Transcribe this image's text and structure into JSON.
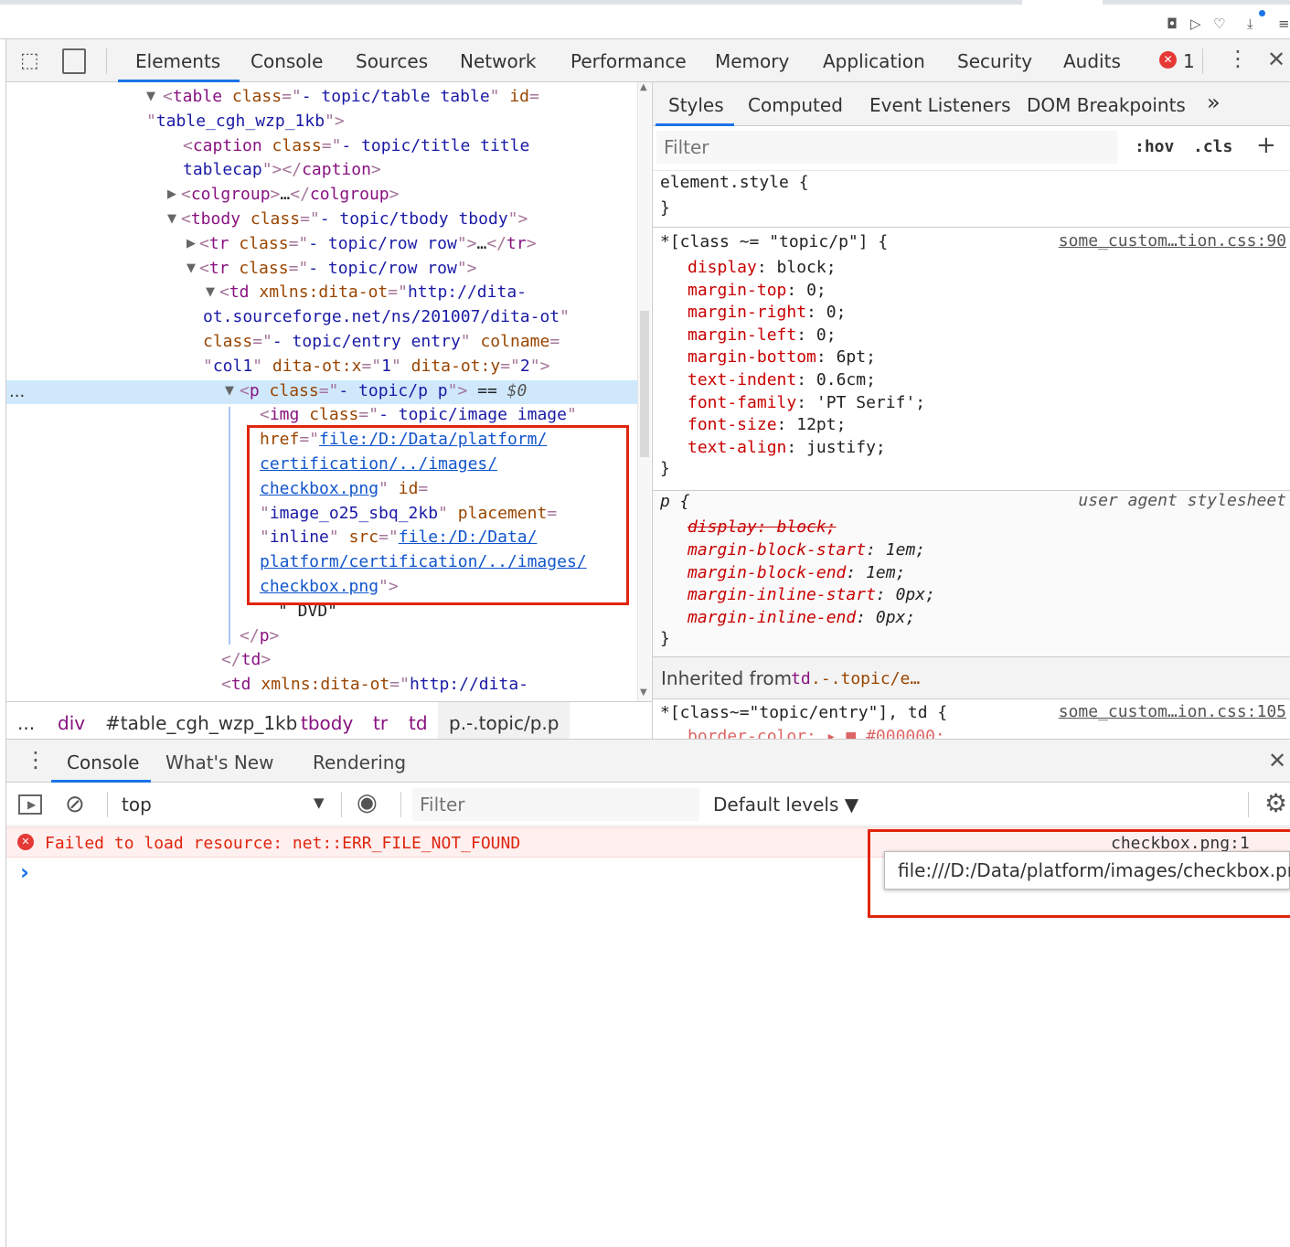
{
  "browser": {
    "icons": [
      "camera-icon",
      "send-icon",
      "heart-icon",
      "download-icon",
      "menu-icon"
    ]
  },
  "devtools": {
    "tabs": [
      "Elements",
      "Console",
      "Sources",
      "Network",
      "Performance",
      "Memory",
      "Application",
      "Security",
      "Audits"
    ],
    "active_tab": "Elements",
    "error_count": "1",
    "accent": "#1a73e8"
  },
  "elements": {
    "selected_marker": "...",
    "lines": [
      {
        "exp": "open",
        "tokens": [
          [
            "punct",
            "<"
          ],
          [
            "tag",
            "table"
          ],
          [
            "text",
            " "
          ],
          [
            "attr",
            "class"
          ],
          [
            "punct",
            "=\""
          ],
          [
            "val",
            "- topic/table table"
          ],
          [
            "punct",
            "\""
          ],
          [
            "text",
            " "
          ],
          [
            "attr",
            "id"
          ],
          [
            "punct",
            "="
          ]
        ]
      },
      {
        "tokens": [
          [
            "punct",
            "\""
          ],
          [
            "val",
            "table_cgh_wzp_1kb"
          ],
          [
            "punct",
            "\">"
          ]
        ]
      },
      {
        "tokens": [
          [
            "punct",
            "<"
          ],
          [
            "tag",
            "caption"
          ],
          [
            "text",
            " "
          ],
          [
            "attr",
            "class"
          ],
          [
            "punct",
            "=\""
          ],
          [
            "val",
            "- topic/title title"
          ]
        ]
      },
      {
        "tokens": [
          [
            "val",
            "tablecap"
          ],
          [
            "punct",
            "\"></"
          ],
          [
            "tag",
            "caption"
          ],
          [
            "punct",
            ">"
          ]
        ]
      },
      {
        "exp": "closed",
        "tokens": [
          [
            "punct",
            "<"
          ],
          [
            "tag",
            "colgroup"
          ],
          [
            "punct",
            ">"
          ],
          [
            "text",
            "…"
          ],
          [
            "punct",
            "</"
          ],
          [
            "tag",
            "colgroup"
          ],
          [
            "punct",
            ">"
          ]
        ]
      },
      {
        "exp": "open",
        "tokens": [
          [
            "punct",
            "<"
          ],
          [
            "tag",
            "tbody"
          ],
          [
            "text",
            " "
          ],
          [
            "attr",
            "class"
          ],
          [
            "punct",
            "=\""
          ],
          [
            "val",
            "- topic/tbody tbody"
          ],
          [
            "punct",
            "\">"
          ]
        ]
      },
      {
        "exp": "closed",
        "tokens": [
          [
            "punct",
            "<"
          ],
          [
            "tag",
            "tr"
          ],
          [
            "text",
            " "
          ],
          [
            "attr",
            "class"
          ],
          [
            "punct",
            "=\""
          ],
          [
            "val",
            "- topic/row row"
          ],
          [
            "punct",
            "\">"
          ],
          [
            "text",
            "…"
          ],
          [
            "punct",
            "</"
          ],
          [
            "tag",
            "tr"
          ],
          [
            "punct",
            ">"
          ]
        ]
      },
      {
        "exp": "open",
        "tokens": [
          [
            "punct",
            "<"
          ],
          [
            "tag",
            "tr"
          ],
          [
            "text",
            " "
          ],
          [
            "attr",
            "class"
          ],
          [
            "punct",
            "=\""
          ],
          [
            "val",
            "- topic/row row"
          ],
          [
            "punct",
            "\">"
          ]
        ]
      },
      {
        "exp": "open",
        "tokens": [
          [
            "punct",
            "<"
          ],
          [
            "tag",
            "td"
          ],
          [
            "text",
            " "
          ],
          [
            "attr",
            "xmlns:dita-ot"
          ],
          [
            "punct",
            "=\""
          ],
          [
            "val",
            "http://dita-"
          ]
        ]
      },
      {
        "tokens": [
          [
            "val",
            "ot.sourceforge.net/ns/201007/dita-ot"
          ],
          [
            "punct",
            "\""
          ]
        ]
      },
      {
        "tokens": [
          [
            "attr",
            "class"
          ],
          [
            "punct",
            "=\""
          ],
          [
            "val",
            "- topic/entry entry"
          ],
          [
            "punct",
            "\""
          ],
          [
            "text",
            " "
          ],
          [
            "attr",
            "colname"
          ],
          [
            "punct",
            "="
          ]
        ]
      },
      {
        "tokens": [
          [
            "punct",
            "\""
          ],
          [
            "val",
            "col1"
          ],
          [
            "punct",
            "\""
          ],
          [
            "text",
            " "
          ],
          [
            "attr",
            "dita-ot:x"
          ],
          [
            "punct",
            "=\""
          ],
          [
            "val",
            "1"
          ],
          [
            "punct",
            "\""
          ],
          [
            "text",
            " "
          ],
          [
            "attr",
            "dita-ot:y"
          ],
          [
            "punct",
            "=\""
          ],
          [
            "val",
            "2"
          ],
          [
            "punct",
            "\">"
          ]
        ]
      },
      {
        "exp": "open",
        "selected": true,
        "tokens": [
          [
            "punct",
            "<"
          ],
          [
            "tag",
            "p"
          ],
          [
            "text",
            " "
          ],
          [
            "attr",
            "class"
          ],
          [
            "punct",
            "=\""
          ],
          [
            "val",
            "- topic/p p"
          ],
          [
            "punct",
            "\">"
          ],
          [
            "text",
            " == "
          ],
          [
            "text",
            "$0"
          ]
        ]
      },
      {
        "tokens": [
          [
            "punct",
            "<"
          ],
          [
            "tag",
            "img"
          ],
          [
            "text",
            " "
          ],
          [
            "attr",
            "class"
          ],
          [
            "punct",
            "=\""
          ],
          [
            "val",
            "- topic/image image"
          ],
          [
            "punct",
            "\""
          ]
        ]
      },
      {
        "tokens": [
          [
            "attr",
            "href"
          ],
          [
            "punct",
            "=\""
          ],
          [
            "link",
            "file:/D:/Data/platform/"
          ]
        ]
      },
      {
        "tokens": [
          [
            "link",
            "certification/../images/"
          ]
        ]
      },
      {
        "tokens": [
          [
            "link",
            "checkbox.png"
          ],
          [
            "punct",
            "\""
          ],
          [
            "text",
            " "
          ],
          [
            "attr",
            "id"
          ],
          [
            "punct",
            "="
          ]
        ]
      },
      {
        "tokens": [
          [
            "punct",
            "\""
          ],
          [
            "val",
            "image_o25_sbq_2kb"
          ],
          [
            "punct",
            "\""
          ],
          [
            "text",
            " "
          ],
          [
            "attr",
            "placement"
          ],
          [
            "punct",
            "="
          ]
        ]
      },
      {
        "tokens": [
          [
            "punct",
            "\""
          ],
          [
            "val",
            "inline"
          ],
          [
            "punct",
            "\""
          ],
          [
            "text",
            " "
          ],
          [
            "attr",
            "src"
          ],
          [
            "punct",
            "=\""
          ],
          [
            "link",
            "file:/D:/Data/"
          ]
        ]
      },
      {
        "tokens": [
          [
            "link",
            "platform/certification/../images/"
          ]
        ]
      },
      {
        "tokens": [
          [
            "link",
            "checkbox.png"
          ],
          [
            "punct",
            "\">"
          ]
        ]
      },
      {
        "tokens": [
          [
            "text",
            "\" DVD\""
          ]
        ]
      },
      {
        "tokens": [
          [
            "punct",
            "</"
          ],
          [
            "tag",
            "p"
          ],
          [
            "punct",
            ">"
          ]
        ]
      },
      {
        "tokens": [
          [
            "punct",
            "</"
          ],
          [
            "tag",
            "td"
          ],
          [
            "punct",
            ">"
          ]
        ]
      },
      {
        "tokens": [
          [
            "punct",
            "<"
          ],
          [
            "tag",
            "td"
          ],
          [
            "text",
            " "
          ],
          [
            "attr",
            "xmlns:dita-ot"
          ],
          [
            "punct",
            "=\""
          ],
          [
            "val",
            "http://dita-"
          ]
        ]
      }
    ]
  },
  "breadcrumbs": [
    "...",
    "div",
    "#table_cgh_wzp_1kb",
    "tbody",
    "tr",
    "td",
    "p.-.topic/p.p"
  ],
  "styles": {
    "tabs": [
      "Styles",
      "Computed",
      "Event Listeners",
      "DOM Breakpoints"
    ],
    "more": "»",
    "filter_placeholder": "Filter",
    "hov": ":hov",
    "cls": ".cls",
    "add": "+",
    "element_style": "element.style {",
    "close_brace": "}",
    "rule1": {
      "selector": "*[class ~= \"topic/p\"] {",
      "source": "some_custom…tion.css:90",
      "props": [
        [
          "display",
          "block"
        ],
        [
          "margin-top",
          "0"
        ],
        [
          "margin-right",
          "0"
        ],
        [
          "margin-left",
          "0"
        ],
        [
          "margin-bottom",
          "6pt"
        ],
        [
          "text-indent",
          "0.6cm"
        ],
        [
          "font-family",
          "'PT Serif'"
        ],
        [
          "font-size",
          "12pt"
        ],
        [
          "text-align",
          "justify"
        ]
      ]
    },
    "rule2": {
      "selector": "p {",
      "source": "user agent stylesheet",
      "struck": "display: block;",
      "props": [
        [
          "margin-block-start",
          "1em"
        ],
        [
          "margin-block-end",
          "1em"
        ],
        [
          "margin-inline-start",
          "0px"
        ],
        [
          "margin-inline-end",
          "0px"
        ]
      ]
    },
    "inherited_label": "Inherited from",
    "inherited_tag": "td",
    "inherited_class": ".-.topic/e…",
    "rule3": {
      "selector": "*[class~=\"topic/entry\"], td {",
      "source": "some_custom…ion.css:105",
      "partial": "border-color: ▸ ■ #000000;"
    }
  },
  "drawer": {
    "tabs": [
      "Console",
      "What's New",
      "Rendering"
    ],
    "context": "top",
    "filter_placeholder": "Filter",
    "levels": "Default levels ▼",
    "error_message": "Failed to load resource: net::ERR_FILE_NOT_FOUND",
    "error_source": "checkbox.png:1",
    "tooltip": "file:///D:/Data/platform/images/checkbox.png",
    "prompt": "›",
    "error_color": "#e0250e"
  }
}
